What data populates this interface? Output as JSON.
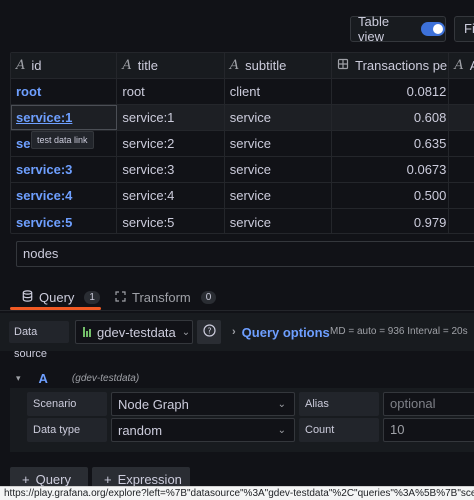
{
  "toolbar": {
    "table_view_label": "Table view",
    "table_view_on": true,
    "filter_button_label": "Fi"
  },
  "table": {
    "columns": [
      {
        "label": "id",
        "type_icon": "text-type-icon"
      },
      {
        "label": "title",
        "type_icon": "text-type-icon"
      },
      {
        "label": "subtitle",
        "type_icon": "text-type-icon"
      },
      {
        "label": "Transactions per",
        "type_icon": "number-type-icon"
      },
      {
        "label": "A",
        "type_icon": "text-type-icon"
      }
    ],
    "rows": [
      {
        "id": "root",
        "title": "root",
        "subtitle": "client",
        "transactions": "0.0812"
      },
      {
        "id": "service:1",
        "title": "service:1",
        "subtitle": "service",
        "transactions": "0.608"
      },
      {
        "id": "service:2",
        "title": "service:2",
        "subtitle": "service",
        "transactions": "0.635"
      },
      {
        "id": "service:3",
        "title": "service:3",
        "subtitle": "service",
        "transactions": "0.0673"
      },
      {
        "id": "service:4",
        "title": "service:4",
        "subtitle": "service",
        "transactions": "0.500"
      },
      {
        "id": "service:5",
        "title": "service:5",
        "subtitle": "service",
        "transactions": "0.979"
      }
    ],
    "tooltip": "test data link",
    "frame_select_value": "nodes"
  },
  "tabs": {
    "query_label": "Query",
    "query_count": "1",
    "transform_label": "Transform",
    "transform_count": "0"
  },
  "datasource": {
    "label": "Data source",
    "value": "gdev-testdata",
    "query_options_label": "Query options",
    "query_options_stats": "MD = auto = 936   Interval = 20s"
  },
  "query_editor": {
    "ref_id": "A",
    "datasource_hint": "(gdev-testdata)",
    "scenario_label": "Scenario",
    "scenario_value": "Node Graph",
    "alias_label": "Alias",
    "alias_placeholder": "optional",
    "data_type_label": "Data type",
    "data_type_value": "random",
    "count_label": "Count",
    "count_value": "10"
  },
  "actions": {
    "add_query_label": "Query",
    "add_expression_label": "Expression"
  },
  "status_bar": {
    "url": "https://play.grafana.org/explore?left=%7B\"datasource\"%3A\"gdev-testdata\"%2C\"queries\"%3A%5B%7B\"scenarioId\"%3A\"node_graph\""
  }
}
